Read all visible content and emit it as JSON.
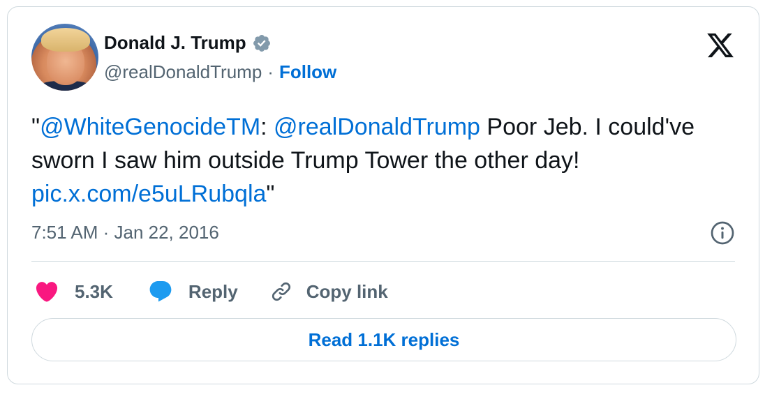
{
  "author": {
    "name": "Donald J. Trump",
    "handle": "@realDonaldTrump",
    "separator": "·",
    "follow_label": "Follow"
  },
  "tweet": {
    "open_quote": "\"",
    "mention1": "@WhiteGenocideTM",
    "colon": ": ",
    "mention2": "@realDonaldTrump",
    "text_part": " Poor Jeb. I could've sworn I saw him outside Trump Tower the other day! ",
    "link": "pic.x.com/e5uLRubqla",
    "close_quote": "\"",
    "timestamp": "7:51 AM · Jan 22, 2016"
  },
  "actions": {
    "likes": "5.3K",
    "reply_label": "Reply",
    "copy_label": "Copy link"
  },
  "read_replies_label": "Read 1.1K replies",
  "colors": {
    "link": "#006fd6",
    "like": "#f91880",
    "reply_icon": "#1d9bf0",
    "muted": "#536471",
    "border": "#cfd9de",
    "verified": "#829aab"
  },
  "icons": [
    "verified-badge-icon",
    "x-logo-icon",
    "info-icon",
    "heart-icon",
    "reply-bubble-icon",
    "link-icon"
  ]
}
